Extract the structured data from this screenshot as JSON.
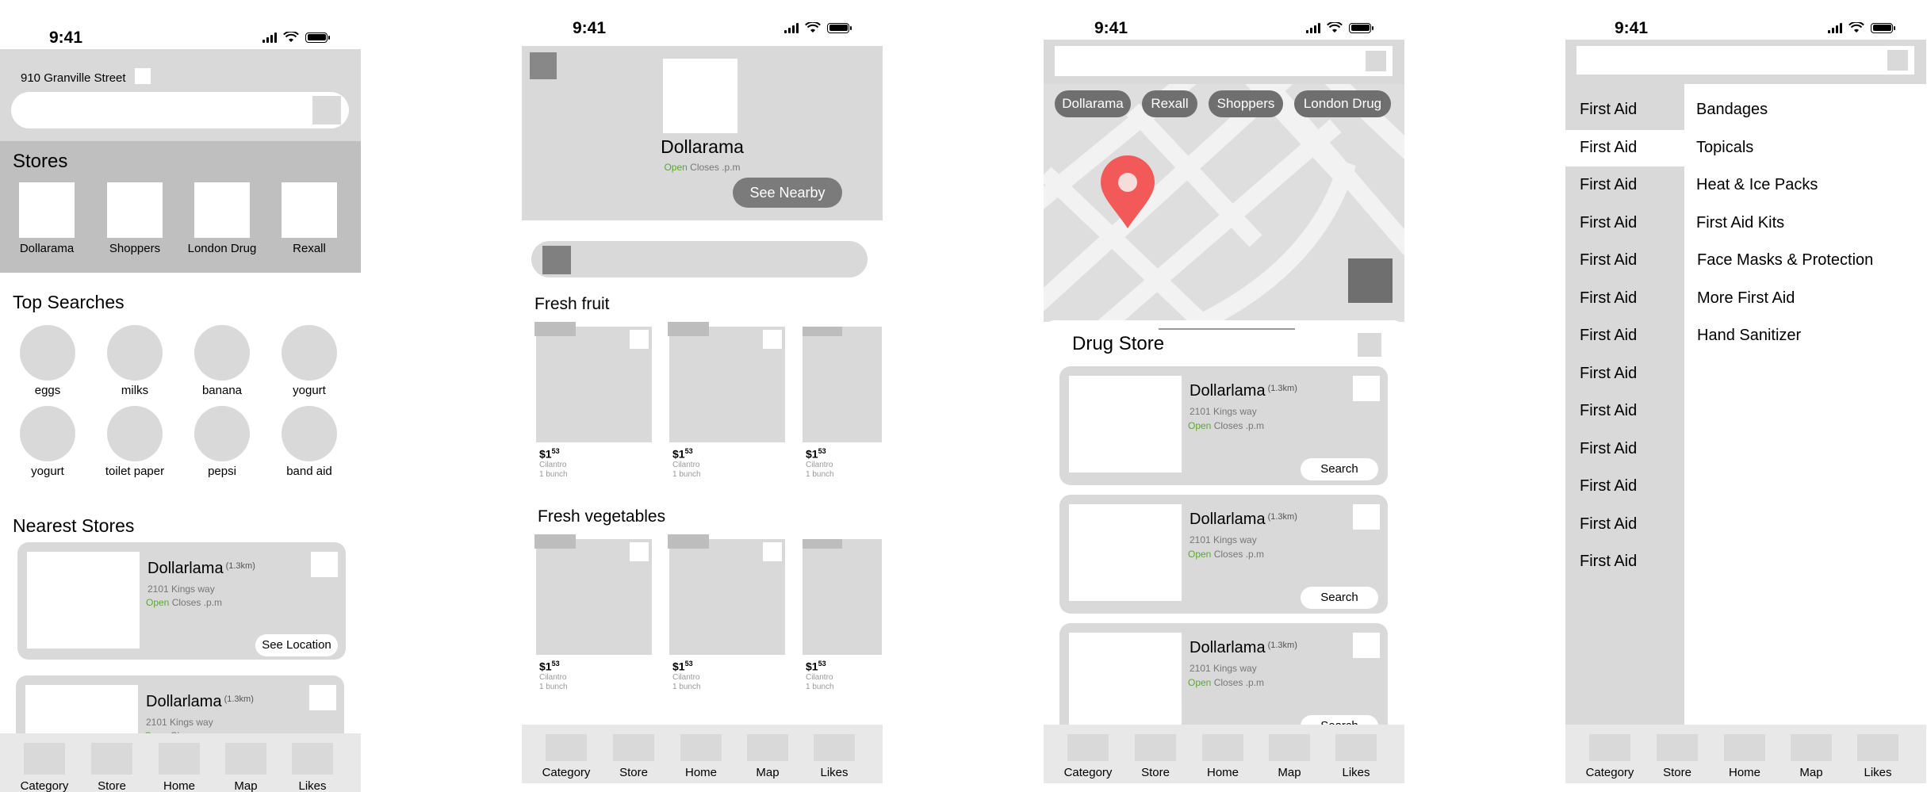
{
  "status": {
    "time": "9:41"
  },
  "tabs": [
    "Category",
    "Store",
    "Home",
    "Map",
    "Likes"
  ],
  "card": {
    "name": "Dollarlama",
    "distance": "(1.3km)",
    "address": "2101 Kings way",
    "open": "Open",
    "closes": "Closes .p.m"
  },
  "home": {
    "address": "910 Granville Street",
    "stores_title": "Stores",
    "stores": [
      "Dollarama",
      "Shoppers",
      "London Drug",
      "Rexall"
    ],
    "top_searches_title": "Top Searches",
    "searches": [
      "eggs",
      "milks",
      "banana",
      "yogurt",
      "yogurt",
      "toilet paper",
      "pepsi",
      "band aid"
    ],
    "nearest_title": "Nearest Stores",
    "see_location": "See Location"
  },
  "store": {
    "name": "Dollarama",
    "open": "Open",
    "closes": "Closes .p.m",
    "see_nearby": "See Nearby",
    "section1": "Fresh fruit",
    "section2": "Fresh vegetables",
    "product": {
      "price_main": "$1",
      "price_cents": "53",
      "name": "Cilantro",
      "unit": "1 bunch"
    }
  },
  "map": {
    "chips": [
      "Dollarama",
      "Rexall",
      "Shoppers",
      "London Drug"
    ],
    "sheet_title": "Drug Store",
    "search_btn": "Search",
    "pin_color": "#f25a5a"
  },
  "category": {
    "left": [
      "First Aid",
      "First Aid",
      "First Aid",
      "First Aid",
      "First Aid",
      "First Aid",
      "First Aid",
      "First Aid",
      "First Aid",
      "First Aid",
      "First Aid",
      "First Aid",
      "First Aid"
    ],
    "right": [
      "Bandages",
      "Topicals",
      "Heat & Ice Packs",
      "First Aid Kits",
      "Face Masks & Protection",
      "More First Aid",
      "Hand Sanitizer"
    ]
  }
}
